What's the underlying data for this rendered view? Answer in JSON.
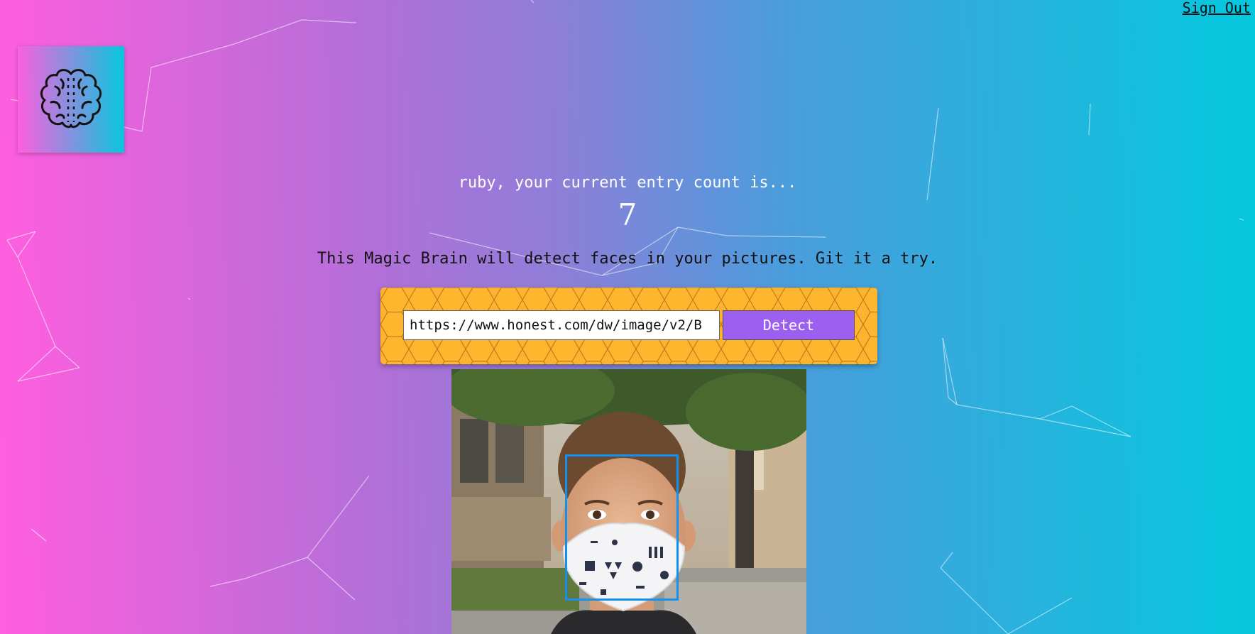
{
  "nav": {
    "sign_out_label": "Sign Out"
  },
  "logo": {
    "icon": "brain-icon"
  },
  "rank": {
    "user_name": "ruby",
    "entry_text": "ruby, your current entry count is...",
    "entry_count": "7"
  },
  "intro": {
    "text": "This Magic Brain will detect faces in your pictures. Git it a try."
  },
  "image_form": {
    "url_value": "https://www.honest.com/dw/image/v2/B",
    "detect_label": "Detect"
  },
  "colors": {
    "gradient_start": "#ff5edf",
    "gradient_end": "#04c8de",
    "form_background": "#fdb32f",
    "detect_button": "#9c5ff0",
    "bounding_box": "#1491ee"
  },
  "face_detection": {
    "faces_detected": 1
  }
}
